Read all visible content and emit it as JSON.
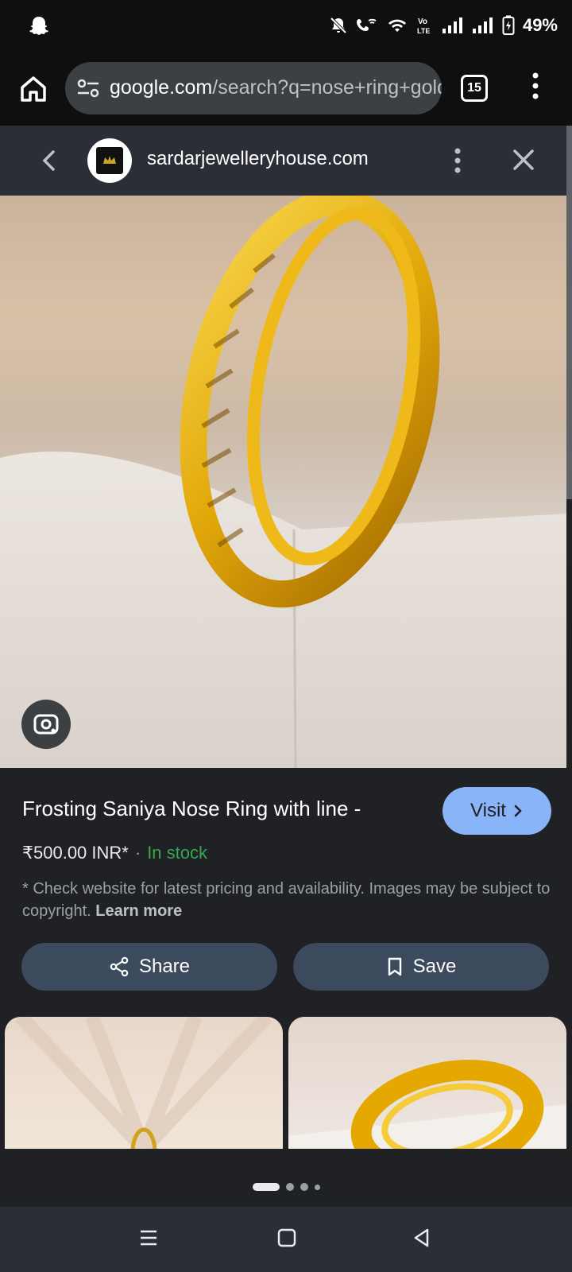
{
  "status_bar": {
    "battery": "49%"
  },
  "browser": {
    "url_host": "google.com",
    "url_path": "/search?q=nose+ring+gold&",
    "tab_count": "15"
  },
  "source": {
    "site": "sardarjewelleryhouse.com"
  },
  "product": {
    "title": "Frosting Saniya Nose Ring with line -",
    "visit_label": "Visit",
    "price": "₹500.00 INR*",
    "separator": "·",
    "stock": "In stock",
    "disclaimer": "* Check website for latest pricing and availability. Images may be subject to copyright.",
    "learn_more": "Learn more",
    "share_label": "Share",
    "save_label": "Save"
  },
  "carousel": {
    "count": 4,
    "active": 0
  }
}
